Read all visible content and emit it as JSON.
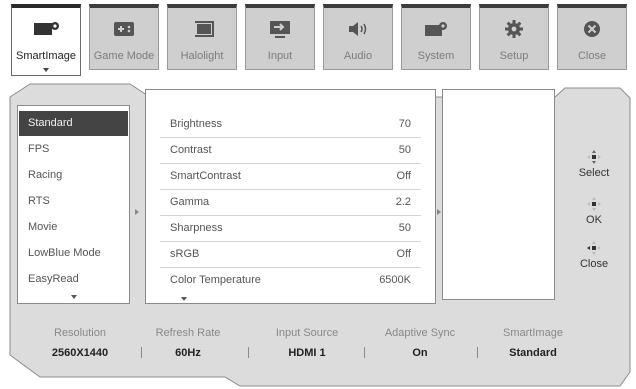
{
  "tabs": [
    {
      "label": "SmartImage",
      "icon": "smartimage-icon",
      "active": true
    },
    {
      "label": "Game Mode",
      "icon": "gamepad-icon",
      "active": false
    },
    {
      "label": "Halolight",
      "icon": "halolight-icon",
      "active": false
    },
    {
      "label": "Input",
      "icon": "input-icon",
      "active": false
    },
    {
      "label": "Audio",
      "icon": "speaker-icon",
      "active": false
    },
    {
      "label": "System",
      "icon": "system-icon",
      "active": false
    },
    {
      "label": "Setup",
      "icon": "gear-icon",
      "active": false
    },
    {
      "label": "Close",
      "icon": "close-icon",
      "active": false
    }
  ],
  "modes": {
    "items": [
      "Standard",
      "FPS",
      "Racing",
      "RTS",
      "Movie",
      "LowBlue Mode",
      "EasyRead"
    ],
    "selected": "Standard"
  },
  "settings": [
    {
      "name": "Brightness",
      "value": "70"
    },
    {
      "name": "Contrast",
      "value": "50"
    },
    {
      "name": "SmartContrast",
      "value": "Off"
    },
    {
      "name": "Gamma",
      "value": "2.2"
    },
    {
      "name": "Sharpness",
      "value": "50"
    },
    {
      "name": "sRGB",
      "value": "Off"
    },
    {
      "name": "Color Temperature",
      "value": "6500K"
    }
  ],
  "controls": {
    "select": "Select",
    "ok": "OK",
    "close": "Close"
  },
  "status": {
    "resolution": {
      "title": "Resolution",
      "value": "2560X1440"
    },
    "refresh": {
      "title": "Refresh Rate",
      "value": "60Hz"
    },
    "input": {
      "title": "Input Source",
      "value": "HDMI 1"
    },
    "sync": {
      "title": "Adaptive Sync",
      "value": "On"
    },
    "smartimage": {
      "title": "SmartImage",
      "value": "Standard"
    }
  },
  "colors": {
    "panel": "#dcdcdc",
    "selected": "#444444",
    "tab_bg": "#cfcfcf"
  }
}
